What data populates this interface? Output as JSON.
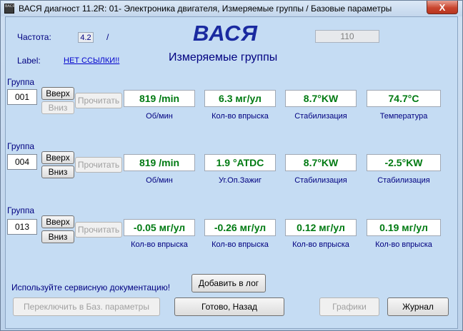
{
  "window": {
    "title": "ВАСЯ диагност 11.2R: 01- Электроника двигателя,  Измеряемые группы / Базовые параметры",
    "icon_text": "ВАСЯ",
    "close_label": "X"
  },
  "header": {
    "freq_label": "Частота:",
    "freq_value": "4.2",
    "freq_slash": "/",
    "brand": "ВАСЯ",
    "code_value": "110",
    "label_caption": "Label:",
    "link_text": "НЕТ ССЫЛКИ!!",
    "subtitle": "Измеряемые группы"
  },
  "groups": [
    {
      "label": "Группа",
      "number": "001",
      "up_label": "Вверх",
      "down_label": "Вниз",
      "down_enabled": false,
      "read_label": "Прочитать",
      "fields": [
        {
          "value": "819 /min",
          "caption": "Об/мин"
        },
        {
          "value": "6.3 мг/ул",
          "caption": "Кол-во впрыска"
        },
        {
          "value": "8.7°KW",
          "caption": "Стабилизация"
        },
        {
          "value": "74.7°C",
          "caption": "Температура"
        }
      ]
    },
    {
      "label": "Группа",
      "number": "004",
      "up_label": "Вверх",
      "down_label": "Вниз",
      "down_enabled": true,
      "read_label": "Прочитать",
      "fields": [
        {
          "value": "819 /min",
          "caption": "Об/мин"
        },
        {
          "value": "1.9 °ATDC",
          "caption": "Уг.Оп.Зажиг"
        },
        {
          "value": "8.7°KW",
          "caption": "Стабилизация"
        },
        {
          "value": "-2.5°KW",
          "caption": "Стабилизация"
        }
      ]
    },
    {
      "label": "Группа",
      "number": "013",
      "up_label": "Вверх",
      "down_label": "Вниз",
      "down_enabled": true,
      "read_label": "Прочитать",
      "fields": [
        {
          "value": "-0.05 мг/ул",
          "caption": "Кол-во впрыска"
        },
        {
          "value": "-0.26 мг/ул",
          "caption": "Кол-во впрыска"
        },
        {
          "value": "0.12 мг/ул",
          "caption": "Кол-во впрыска"
        },
        {
          "value": "0.19 мг/ул",
          "caption": "Кол-во впрыска"
        }
      ]
    }
  ],
  "footer": {
    "note": "Используйте сервисную документацию!",
    "add_log_label": "Добавить в лог",
    "switch_label": "Переключить в Баз. параметры",
    "done_label": "Готово, Назад",
    "graphs_label": "Графики",
    "journal_label": "Журнал"
  }
}
